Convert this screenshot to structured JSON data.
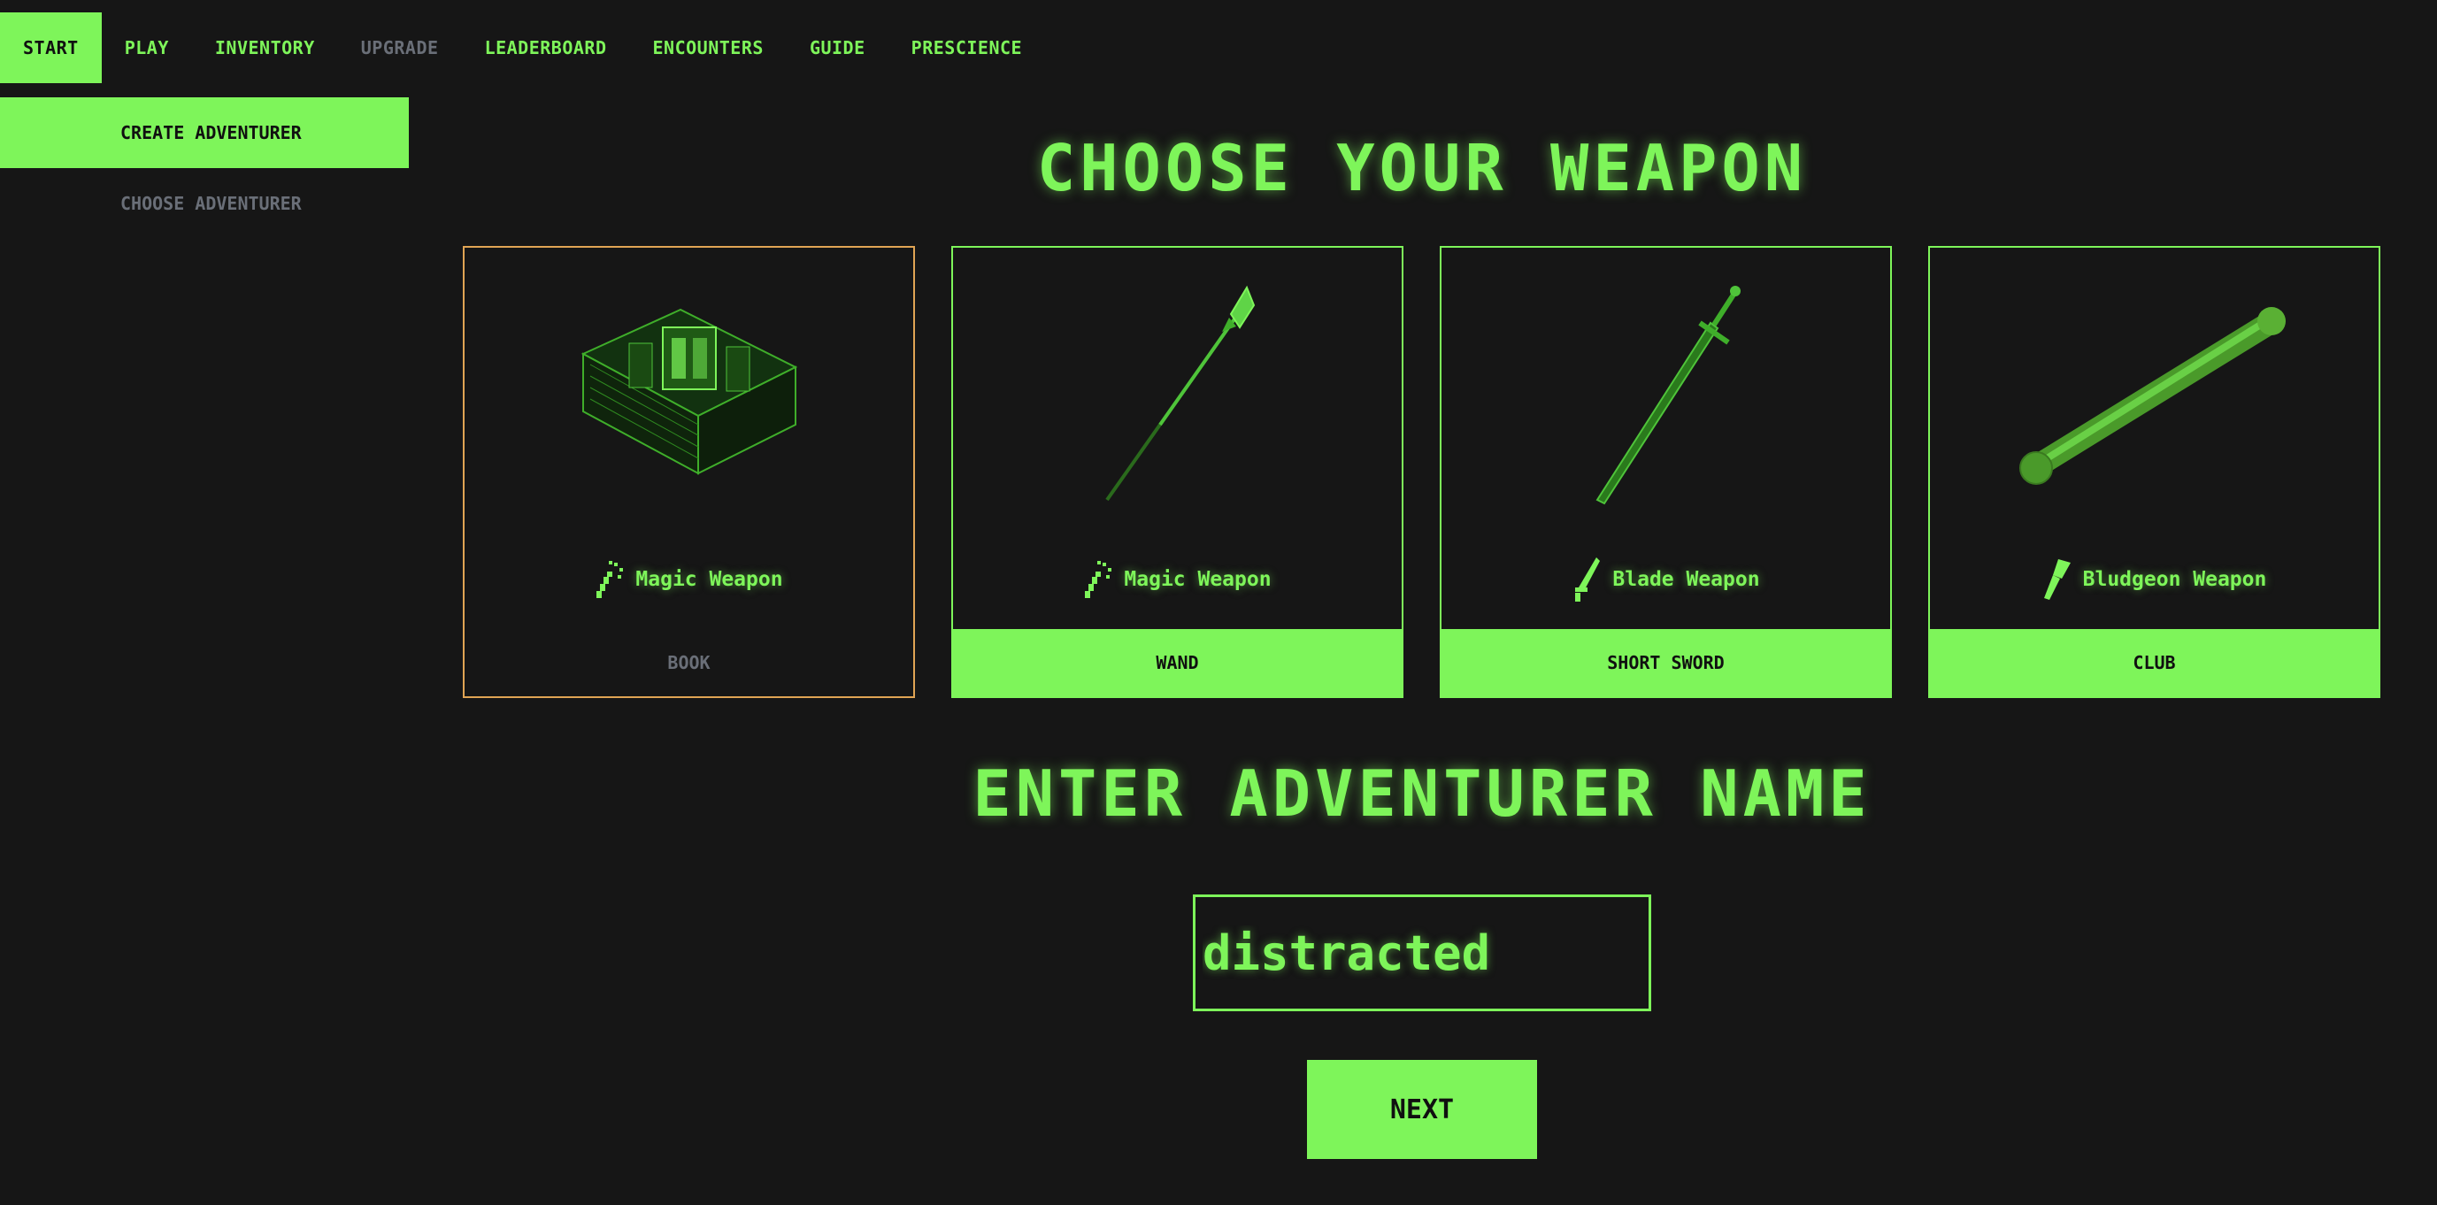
{
  "nav": {
    "tabs": [
      {
        "label": "START",
        "state": "active"
      },
      {
        "label": "PLAY",
        "state": "normal"
      },
      {
        "label": "INVENTORY",
        "state": "normal"
      },
      {
        "label": "UPGRADE",
        "state": "disabled"
      },
      {
        "label": "LEADERBOARD",
        "state": "normal"
      },
      {
        "label": "ENCOUNTERS",
        "state": "normal"
      },
      {
        "label": "GUIDE",
        "state": "normal"
      },
      {
        "label": "PRESCIENCE",
        "state": "normal"
      }
    ]
  },
  "subnav": {
    "items": [
      {
        "label": "CREATE ADVENTURER",
        "state": "active"
      },
      {
        "label": "CHOOSE ADVENTURER",
        "state": "normal"
      }
    ]
  },
  "weapons_section": {
    "title": "CHOOSE YOUR WEAPON",
    "cards": [
      {
        "type_label": "Magic Weapon",
        "type_icon": "wand-icon",
        "name": "BOOK",
        "selected": true,
        "art": "book-icon"
      },
      {
        "type_label": "Magic Weapon",
        "type_icon": "wand-icon",
        "name": "WAND",
        "selected": false,
        "art": "spear-wand-icon"
      },
      {
        "type_label": "Blade Weapon",
        "type_icon": "blade-icon",
        "name": "SHORT SWORD",
        "selected": false,
        "art": "sword-icon"
      },
      {
        "type_label": "Bludgeon Weapon",
        "type_icon": "club-icon",
        "name": "CLUB",
        "selected": false,
        "art": "club-icon"
      }
    ]
  },
  "name_section": {
    "title": "ENTER ADVENTURER NAME",
    "input_value": "distracted"
  },
  "next_button": {
    "label": "NEXT"
  },
  "colors": {
    "accent": "#7ef55a",
    "background": "#161616",
    "selected_border": "#e0a454",
    "muted": "#6a6f78"
  }
}
